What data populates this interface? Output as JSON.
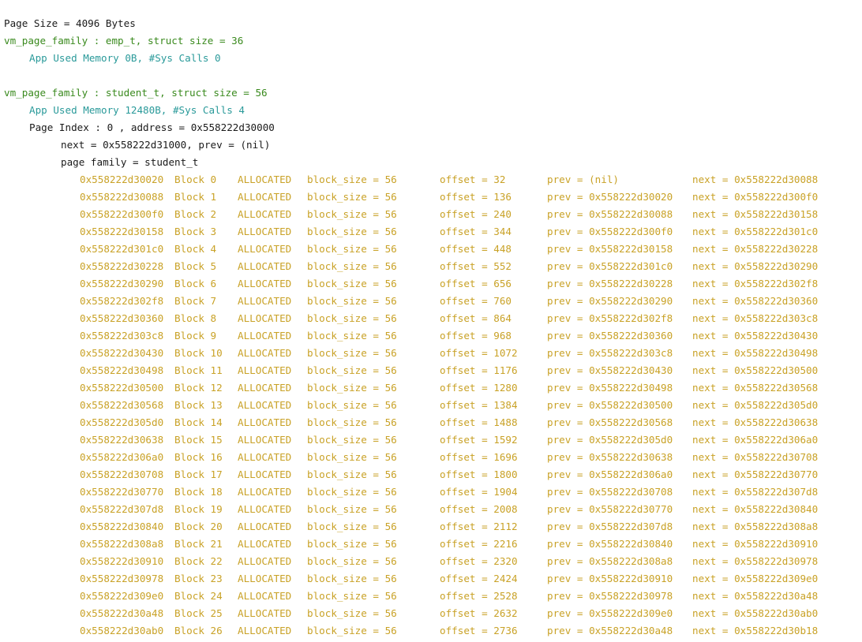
{
  "header": {
    "page_size": "Page Size = 4096 Bytes"
  },
  "families": [
    {
      "title": "vm_page_family : emp_t, struct size = 36",
      "usage": "App Used Memory 0B, #Sys Calls 0"
    },
    {
      "title": "vm_page_family : student_t, struct size = 56",
      "usage": "App Used Memory 12480B, #Sys Calls 4",
      "page_index": "Page Index : 0 , address = 0x558222d30000",
      "links": "next = 0x558222d31000, prev = (nil)",
      "page_family": "page family = student_t"
    }
  ],
  "blocks": [
    {
      "addr": "0x558222d30020",
      "block": "Block 0",
      "state": "ALLOCATED",
      "bsize": "block_size = 56",
      "offset": "offset = 32",
      "prev": "prev = (nil)",
      "next": "next = 0x558222d30088"
    },
    {
      "addr": "0x558222d30088",
      "block": "Block 1",
      "state": "ALLOCATED",
      "bsize": "block_size = 56",
      "offset": "offset = 136",
      "prev": "prev = 0x558222d30020",
      "next": "next = 0x558222d300f0"
    },
    {
      "addr": "0x558222d300f0",
      "block": "Block 2",
      "state": "ALLOCATED",
      "bsize": "block_size = 56",
      "offset": "offset = 240",
      "prev": "prev = 0x558222d30088",
      "next": "next = 0x558222d30158"
    },
    {
      "addr": "0x558222d30158",
      "block": "Block 3",
      "state": "ALLOCATED",
      "bsize": "block_size = 56",
      "offset": "offset = 344",
      "prev": "prev = 0x558222d300f0",
      "next": "next = 0x558222d301c0"
    },
    {
      "addr": "0x558222d301c0",
      "block": "Block 4",
      "state": "ALLOCATED",
      "bsize": "block_size = 56",
      "offset": "offset = 448",
      "prev": "prev = 0x558222d30158",
      "next": "next = 0x558222d30228"
    },
    {
      "addr": "0x558222d30228",
      "block": "Block 5",
      "state": "ALLOCATED",
      "bsize": "block_size = 56",
      "offset": "offset = 552",
      "prev": "prev = 0x558222d301c0",
      "next": "next = 0x558222d30290"
    },
    {
      "addr": "0x558222d30290",
      "block": "Block 6",
      "state": "ALLOCATED",
      "bsize": "block_size = 56",
      "offset": "offset = 656",
      "prev": "prev = 0x558222d30228",
      "next": "next = 0x558222d302f8"
    },
    {
      "addr": "0x558222d302f8",
      "block": "Block 7",
      "state": "ALLOCATED",
      "bsize": "block_size = 56",
      "offset": "offset = 760",
      "prev": "prev = 0x558222d30290",
      "next": "next = 0x558222d30360"
    },
    {
      "addr": "0x558222d30360",
      "block": "Block 8",
      "state": "ALLOCATED",
      "bsize": "block_size = 56",
      "offset": "offset = 864",
      "prev": "prev = 0x558222d302f8",
      "next": "next = 0x558222d303c8"
    },
    {
      "addr": "0x558222d303c8",
      "block": "Block 9",
      "state": "ALLOCATED",
      "bsize": "block_size = 56",
      "offset": "offset = 968",
      "prev": "prev = 0x558222d30360",
      "next": "next = 0x558222d30430"
    },
    {
      "addr": "0x558222d30430",
      "block": "Block 10",
      "state": "ALLOCATED",
      "bsize": "block_size = 56",
      "offset": "offset = 1072",
      "prev": "prev = 0x558222d303c8",
      "next": "next = 0x558222d30498"
    },
    {
      "addr": "0x558222d30498",
      "block": "Block 11",
      "state": "ALLOCATED",
      "bsize": "block_size = 56",
      "offset": "offset = 1176",
      "prev": "prev = 0x558222d30430",
      "next": "next = 0x558222d30500"
    },
    {
      "addr": "0x558222d30500",
      "block": "Block 12",
      "state": "ALLOCATED",
      "bsize": "block_size = 56",
      "offset": "offset = 1280",
      "prev": "prev = 0x558222d30498",
      "next": "next = 0x558222d30568"
    },
    {
      "addr": "0x558222d30568",
      "block": "Block 13",
      "state": "ALLOCATED",
      "bsize": "block_size = 56",
      "offset": "offset = 1384",
      "prev": "prev = 0x558222d30500",
      "next": "next = 0x558222d305d0"
    },
    {
      "addr": "0x558222d305d0",
      "block": "Block 14",
      "state": "ALLOCATED",
      "bsize": "block_size = 56",
      "offset": "offset = 1488",
      "prev": "prev = 0x558222d30568",
      "next": "next = 0x558222d30638"
    },
    {
      "addr": "0x558222d30638",
      "block": "Block 15",
      "state": "ALLOCATED",
      "bsize": "block_size = 56",
      "offset": "offset = 1592",
      "prev": "prev = 0x558222d305d0",
      "next": "next = 0x558222d306a0"
    },
    {
      "addr": "0x558222d306a0",
      "block": "Block 16",
      "state": "ALLOCATED",
      "bsize": "block_size = 56",
      "offset": "offset = 1696",
      "prev": "prev = 0x558222d30638",
      "next": "next = 0x558222d30708"
    },
    {
      "addr": "0x558222d30708",
      "block": "Block 17",
      "state": "ALLOCATED",
      "bsize": "block_size = 56",
      "offset": "offset = 1800",
      "prev": "prev = 0x558222d306a0",
      "next": "next = 0x558222d30770"
    },
    {
      "addr": "0x558222d30770",
      "block": "Block 18",
      "state": "ALLOCATED",
      "bsize": "block_size = 56",
      "offset": "offset = 1904",
      "prev": "prev = 0x558222d30708",
      "next": "next = 0x558222d307d8"
    },
    {
      "addr": "0x558222d307d8",
      "block": "Block 19",
      "state": "ALLOCATED",
      "bsize": "block_size = 56",
      "offset": "offset = 2008",
      "prev": "prev = 0x558222d30770",
      "next": "next = 0x558222d30840"
    },
    {
      "addr": "0x558222d30840",
      "block": "Block 20",
      "state": "ALLOCATED",
      "bsize": "block_size = 56",
      "offset": "offset = 2112",
      "prev": "prev = 0x558222d307d8",
      "next": "next = 0x558222d308a8"
    },
    {
      "addr": "0x558222d308a8",
      "block": "Block 21",
      "state": "ALLOCATED",
      "bsize": "block_size = 56",
      "offset": "offset = 2216",
      "prev": "prev = 0x558222d30840",
      "next": "next = 0x558222d30910"
    },
    {
      "addr": "0x558222d30910",
      "block": "Block 22",
      "state": "ALLOCATED",
      "bsize": "block_size = 56",
      "offset": "offset = 2320",
      "prev": "prev = 0x558222d308a8",
      "next": "next = 0x558222d30978"
    },
    {
      "addr": "0x558222d30978",
      "block": "Block 23",
      "state": "ALLOCATED",
      "bsize": "block_size = 56",
      "offset": "offset = 2424",
      "prev": "prev = 0x558222d30910",
      "next": "next = 0x558222d309e0"
    },
    {
      "addr": "0x558222d309e0",
      "block": "Block 24",
      "state": "ALLOCATED",
      "bsize": "block_size = 56",
      "offset": "offset = 2528",
      "prev": "prev = 0x558222d30978",
      "next": "next = 0x558222d30a48"
    },
    {
      "addr": "0x558222d30a48",
      "block": "Block 25",
      "state": "ALLOCATED",
      "bsize": "block_size = 56",
      "offset": "offset = 2632",
      "prev": "prev = 0x558222d309e0",
      "next": "next = 0x558222d30ab0"
    },
    {
      "addr": "0x558222d30ab0",
      "block": "Block 26",
      "state": "ALLOCATED",
      "bsize": "block_size = 56",
      "offset": "offset = 2736",
      "prev": "prev = 0x558222d30a48",
      "next": "next = 0x558222d30b18"
    }
  ]
}
